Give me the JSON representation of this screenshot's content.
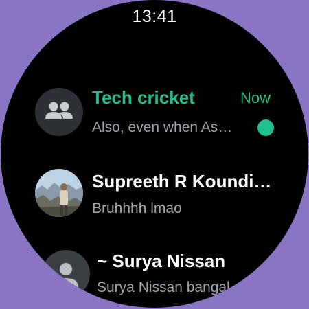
{
  "status_bar": {
    "time": "13:41"
  },
  "chats": [
    {
      "name": "Tech cricket",
      "preview": "Also, even when As…",
      "time": "Now",
      "unread": true,
      "avatar": "group-icon"
    },
    {
      "name": "Supreeth R Koundi…",
      "preview": "Bruhhhh lmao",
      "avatar": "profile-photo"
    },
    {
      "name": "~ Surya Nissan",
      "preview": "Surya Nissan bangal",
      "avatar": "person-icon"
    }
  ],
  "colors": {
    "accent": "#1fbf8f",
    "background": "#000000",
    "frame": "#8a74c4",
    "secondary_text": "#9aa4ad"
  }
}
